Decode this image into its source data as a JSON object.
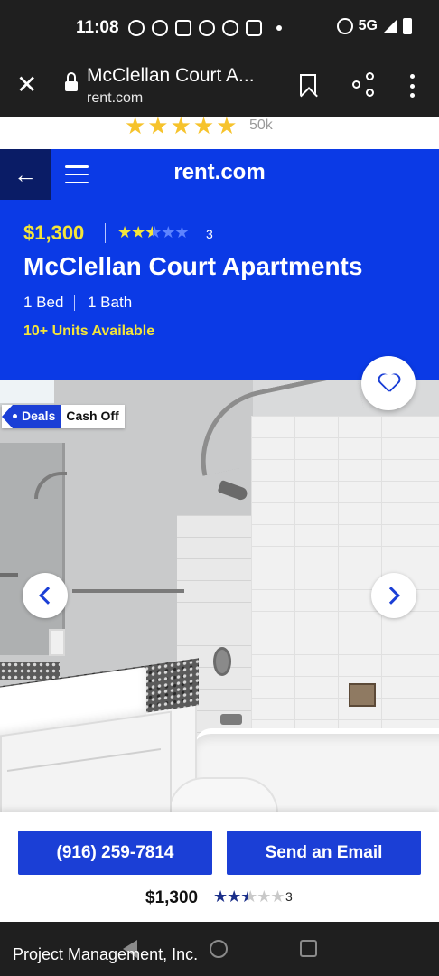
{
  "status_bar": {
    "time": "11:08",
    "network": "5G",
    "icons": [
      "chat-icon",
      "chrome-icon",
      "gmail-icon",
      "chrome-icon",
      "messenger-icon",
      "gmail-icon",
      "alarm-icon",
      "signal-icon",
      "battery-icon"
    ]
  },
  "browser": {
    "page_title": "McClellan Court A...",
    "url": "rent.com",
    "icons": [
      "close-icon",
      "lock-icon",
      "bookmark-icon",
      "share-icon",
      "more-vert-icon"
    ]
  },
  "promo": {
    "rating_stars": 5,
    "review_count": "50k"
  },
  "header": {
    "brand": "rent.com",
    "back_icon": "arrow-left-icon",
    "menu_icon": "hamburger-icon",
    "price": "$1,300",
    "rating": 2.5,
    "rating_max": 5,
    "review_count": "3",
    "title": "McClellan Court Apartments",
    "beds": "1 Bed",
    "baths": "1 Bath",
    "availability": "10+ Units Available"
  },
  "gallery": {
    "image_subject": "bathroom",
    "deal_tag": "Deals",
    "deal_text": "Cash Off",
    "favorite_icon": "heart-icon",
    "prev_icon": "chevron-left-icon",
    "next_icon": "chevron-right-icon"
  },
  "cta": {
    "phone_label": "(916) 259-7814",
    "email_label": "Send an Email",
    "price": "$1,300",
    "rating": 2.5,
    "review_count": "3"
  },
  "footer": {
    "text": "Project Management, Inc."
  },
  "colors": {
    "brand_blue": "#0b3ae6",
    "button_blue": "#1b3fd6",
    "accent_yellow": "#f4e53a",
    "system_bar": "#1f1f1f"
  }
}
